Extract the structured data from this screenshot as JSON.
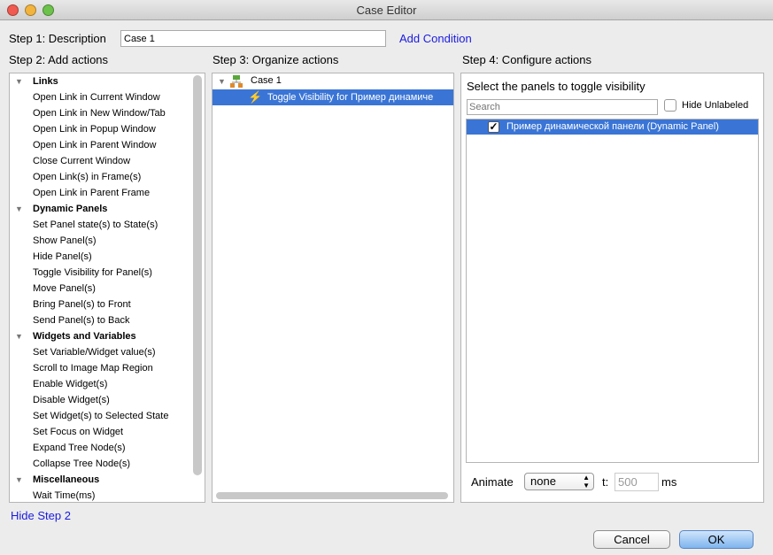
{
  "window": {
    "title": "Case Editor"
  },
  "step1": {
    "label": "Step 1: Description",
    "value": "Case 1",
    "add_condition": "Add Condition"
  },
  "step2": {
    "label": "Step 2: Add actions",
    "hide": "Hide Step 2",
    "groups": [
      {
        "label": "Links",
        "items": [
          "Open Link in Current Window",
          "Open Link in New Window/Tab",
          "Open Link in Popup Window",
          "Open Link in Parent Window",
          "Close Current Window",
          "Open Link(s) in Frame(s)",
          "Open Link in Parent Frame"
        ]
      },
      {
        "label": "Dynamic Panels",
        "items": [
          "Set Panel state(s) to State(s)",
          "Show Panel(s)",
          "Hide Panel(s)",
          "Toggle Visibility for Panel(s)",
          "Move Panel(s)",
          "Bring Panel(s) to Front",
          "Send Panel(s) to Back"
        ]
      },
      {
        "label": "Widgets and Variables",
        "items": [
          "Set Variable/Widget value(s)",
          "Scroll to Image Map Region",
          "Enable Widget(s)",
          "Disable Widget(s)",
          "Set Widget(s) to Selected State",
          "Set Focus on Widget",
          "Expand Tree Node(s)",
          "Collapse Tree Node(s)"
        ]
      },
      {
        "label": "Miscellaneous",
        "items": [
          "Wait Time(ms)"
        ]
      }
    ]
  },
  "step3": {
    "label": "Step 3: Organize actions",
    "case": "Case 1",
    "action": "Toggle Visibility for Пример динамиче"
  },
  "step4": {
    "label": "Step 4: Configure actions",
    "heading": "Select the panels to toggle visibility",
    "search_placeholder": "Search",
    "hide_unlabeled": "Hide Unlabeled",
    "panels": [
      {
        "label": "Пример динамической панели (Dynamic Panel)",
        "checked": true
      }
    ],
    "animate_label": "Animate",
    "animate_value": "none",
    "t_label": "t:",
    "t_value": "500",
    "ms": "ms"
  },
  "buttons": {
    "cancel": "Cancel",
    "ok": "OK"
  },
  "colors": {
    "selection": "#3a75d6",
    "link": "#1a1ae0"
  }
}
